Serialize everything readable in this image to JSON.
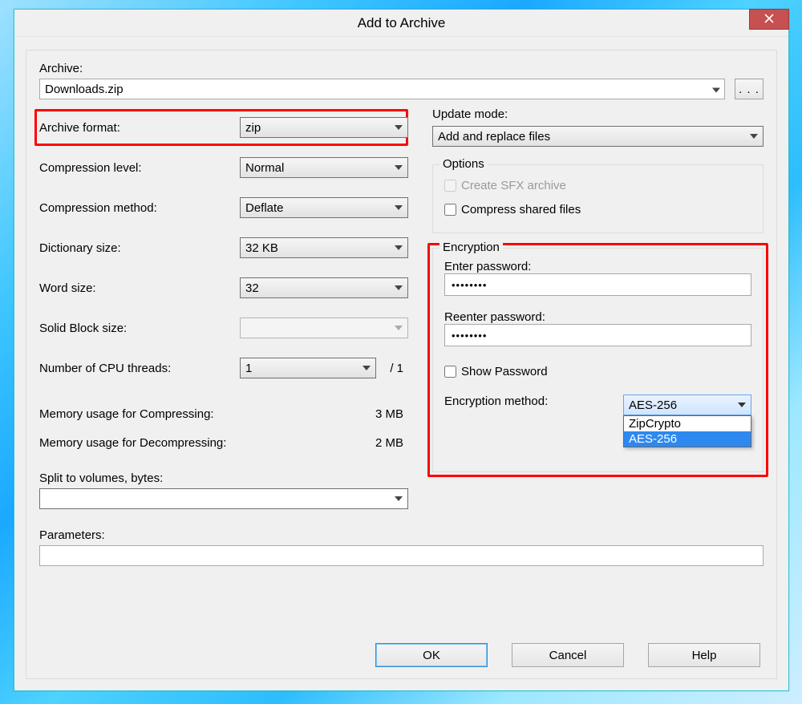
{
  "window": {
    "title": "Add to Archive"
  },
  "archive": {
    "label": "Archive:",
    "value": "Downloads.zip",
    "browse": ". . ."
  },
  "left": {
    "format_label": "Archive format:",
    "format_value": "zip",
    "level_label": "Compression level:",
    "level_value": "Normal",
    "method_label": "Compression method:",
    "method_value": "Deflate",
    "dict_label": "Dictionary size:",
    "dict_value": "32 KB",
    "word_label": "Word size:",
    "word_value": "32",
    "solid_label": "Solid Block size:",
    "solid_value": "",
    "threads_label": "Number of CPU threads:",
    "threads_value": "1",
    "threads_total": "/ 1",
    "mem_comp_label": "Memory usage for Compressing:",
    "mem_comp_value": "3 MB",
    "mem_decomp_label": "Memory usage for Decompressing:",
    "mem_decomp_value": "2 MB",
    "split_label": "Split to volumes, bytes:",
    "split_value": ""
  },
  "right": {
    "update_label": "Update mode:",
    "update_value": "Add and replace files",
    "options_title": "Options",
    "sfx_label": "Create SFX archive",
    "shared_label": "Compress shared files",
    "enc_title": "Encryption",
    "pw1_label": "Enter password:",
    "pw1_value": "••••••••",
    "pw2_label": "Reenter password:",
    "pw2_value": "••••••••",
    "showpw_label": "Show Password",
    "encmethod_label": "Encryption method:",
    "encmethod_value": "AES-256",
    "encmethod_options": [
      "ZipCrypto",
      "AES-256"
    ]
  },
  "params": {
    "label": "Parameters:",
    "value": ""
  },
  "buttons": {
    "ok": "OK",
    "cancel": "Cancel",
    "help": "Help"
  }
}
